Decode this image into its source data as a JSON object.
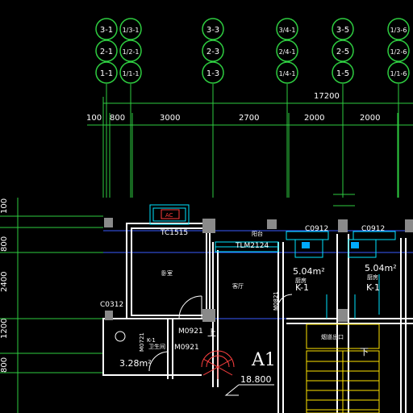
{
  "colors": {
    "background": "#000000",
    "axis_green": "#2ecc40",
    "wall_white": "#ffffff",
    "wall_blue": "#3a5cff",
    "column_grey": "#8a8a8a",
    "window_cyan": "#00e5ff",
    "stair_yellow": "#ffe400",
    "door_white": "#ffffff",
    "text_white": "#ffffff",
    "magenta": "#ff00ff",
    "red": "#ff3030"
  },
  "axis_columns": [
    {
      "labels": [
        "3-1",
        "2-1",
        "1-1"
      ]
    },
    {
      "labels": [
        "1/3-1",
        "1/2-1",
        "1/1-1"
      ]
    },
    {
      "labels": [
        "3-3",
        "2-3",
        "1-3"
      ]
    },
    {
      "labels": [
        "3/4-1",
        "2/4-1",
        "1/4-1"
      ]
    },
    {
      "labels": [
        "3-5",
        "2-5",
        "1-5"
      ]
    },
    {
      "labels": [
        "1/3-6",
        "1/2-6",
        "1/1-6"
      ]
    }
  ],
  "dimensions": {
    "overall": "17200",
    "segments": [
      "100",
      "800",
      "3000",
      "2700",
      "2000",
      "2000"
    ],
    "left_vertical": [
      "100",
      "800",
      "2400",
      "1200",
      "800"
    ]
  },
  "labels": {
    "window_ac": "AC",
    "tc1515": "TC1515",
    "tlm2124": "TLM2124",
    "balcony": "阳台",
    "c0912_a": "C0912",
    "c0912_b": "C0912",
    "bedroom": "卧室",
    "living_room": "客厅",
    "kitchen_area_a": "5.04m²",
    "kitchen_area_b": "5.04m²",
    "kitchen_name_a": "厨房",
    "kitchen_name_b": "厨房",
    "k1_a": "K-1",
    "k1_b": "K-1",
    "m0821": "M0821",
    "c0312": "C0312",
    "m0721": "M0721",
    "m0921_a": "M0921",
    "m0921_b": "M0921",
    "up": "上",
    "down": "下",
    "bath_area": "3.28m²",
    "bath_k": "K-1",
    "bath_name": "卫生间",
    "unit_name": "A1",
    "elevation": "18.800",
    "smoke_outlet": "烟道出口"
  }
}
